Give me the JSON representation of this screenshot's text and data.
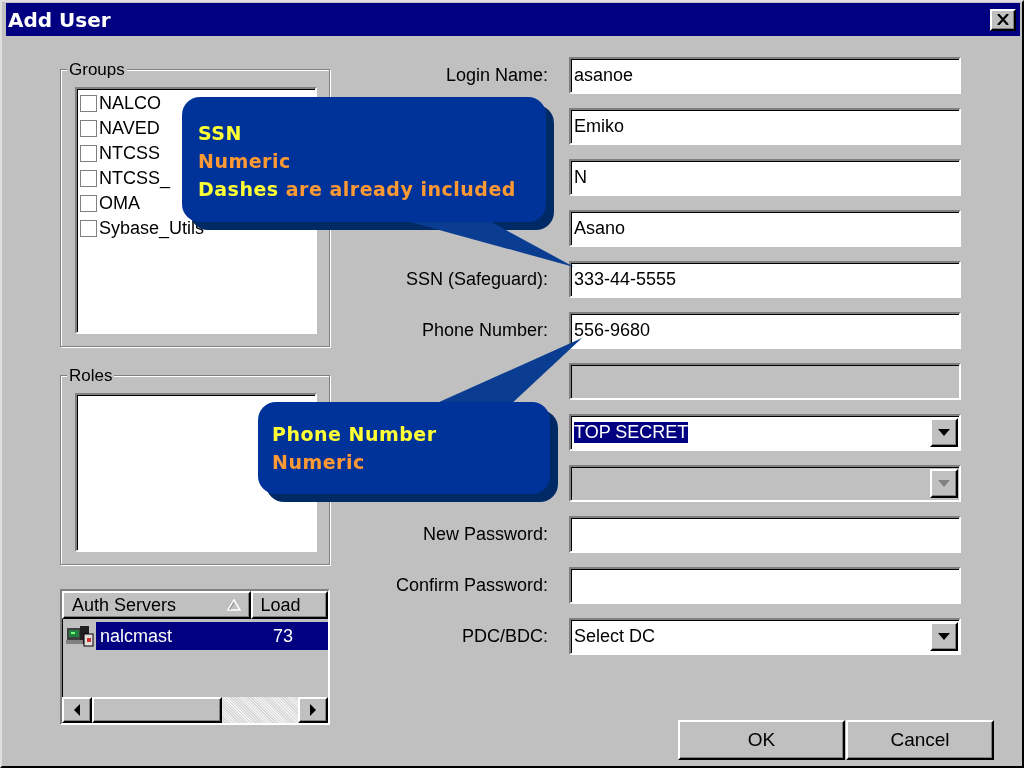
{
  "window": {
    "title": "Add User"
  },
  "groups": {
    "title": "Groups",
    "items": [
      {
        "label": "NALCO",
        "checked": false
      },
      {
        "label": "NAVED",
        "checked": false
      },
      {
        "label": "NTCSS",
        "checked": false
      },
      {
        "label": "NTCSS_",
        "checked": false
      },
      {
        "label": "OMA",
        "checked": false
      },
      {
        "label": "Sybase_Utils",
        "checked": false
      }
    ]
  },
  "roles": {
    "title": "Roles"
  },
  "auth_servers": {
    "columns": [
      "Auth Servers",
      "Load"
    ],
    "rows": [
      {
        "cells": [
          "nalcmast",
          "73"
        ],
        "selected": true
      }
    ]
  },
  "fields": [
    {
      "kind": "text",
      "label": "Login Name:",
      "value": "asanoe",
      "disabled": false
    },
    {
      "kind": "text",
      "value": "Emiko",
      "disabled": false
    },
    {
      "kind": "text",
      "value": "N",
      "disabled": false
    },
    {
      "kind": "text",
      "value": "Asano",
      "disabled": false
    },
    {
      "kind": "text",
      "label": "SSN (Safeguard):",
      "value": "333-44-5555",
      "disabled": false
    },
    {
      "kind": "text",
      "label": "Phone Number:",
      "value": "556-9680",
      "disabled": false
    },
    {
      "kind": "text",
      "disabled": true
    },
    {
      "kind": "combo",
      "value": "TOP SECRET",
      "highlighted": true,
      "disabled": false
    },
    {
      "kind": "combo",
      "disabled": true
    },
    {
      "kind": "text",
      "label": "New Password:",
      "disabled": false
    },
    {
      "kind": "text",
      "label": "Confirm Password:",
      "disabled": false
    },
    {
      "kind": "combo",
      "label": "PDC/BDC:",
      "value": "Select DC",
      "highlighted": false,
      "disabled": false
    }
  ],
  "buttons": [
    "OK",
    "Cancel"
  ],
  "callouts": [
    {
      "kind": "upper",
      "lines": [
        [
          {
            "text": "SSN",
            "color": "#ffff33"
          }
        ],
        [
          {
            "text": "Numeric",
            "color": "#ff9933"
          }
        ],
        [
          {
            "text": "Dashes",
            "color": "#ffff33"
          },
          {
            "text": " are already included",
            "color": "#ff9933"
          }
        ]
      ]
    },
    {
      "kind": "lower",
      "lines": [
        [
          {
            "text": "Phone Number",
            "color": "#ffff33"
          }
        ],
        [
          {
            "text": "Numeric",
            "color": "#ff9933"
          }
        ]
      ]
    }
  ]
}
